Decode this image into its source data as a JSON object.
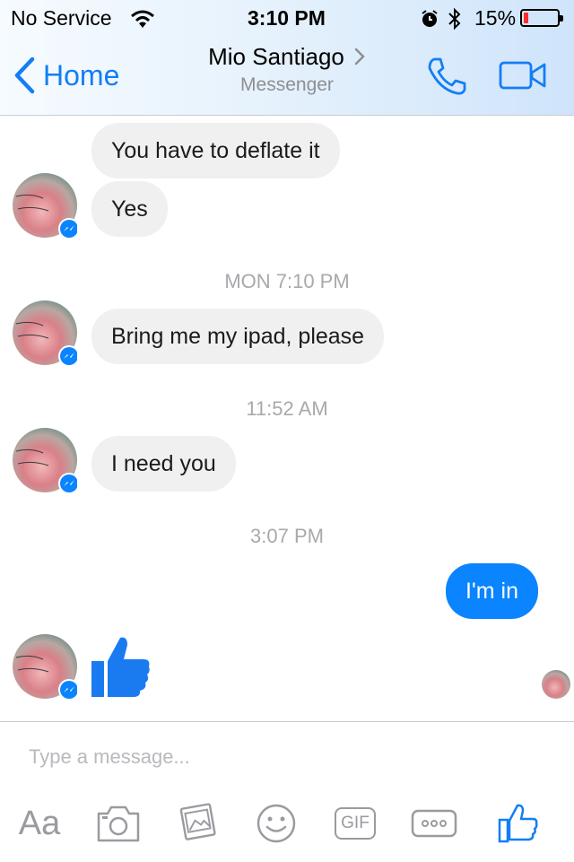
{
  "status_bar": {
    "carrier": "No Service",
    "time": "3:10 PM",
    "battery": "15%",
    "battery_level": 0.15
  },
  "nav": {
    "back_label": "Home",
    "contact_name": "Mio Santiago",
    "subtitle": "Messenger"
  },
  "messages": {
    "m1": "You have to deflate it",
    "m2": "Yes",
    "ts1": "MON 7:10 PM",
    "m3": "Bring me my ipad, please",
    "ts2": "11:52 AM",
    "m4": "I need you",
    "ts3": "3:07 PM",
    "m5": "I'm in"
  },
  "composer": {
    "placeholder": "Type a message...",
    "text_label": "Aa",
    "gif_label": "GIF"
  },
  "colors": {
    "accent": "#137ef3",
    "outgoing_bubble": "#0a84ff",
    "incoming_bubble": "#f1f0f0",
    "like": "#1a7bf0",
    "battery_low": "#ff2d2d"
  }
}
